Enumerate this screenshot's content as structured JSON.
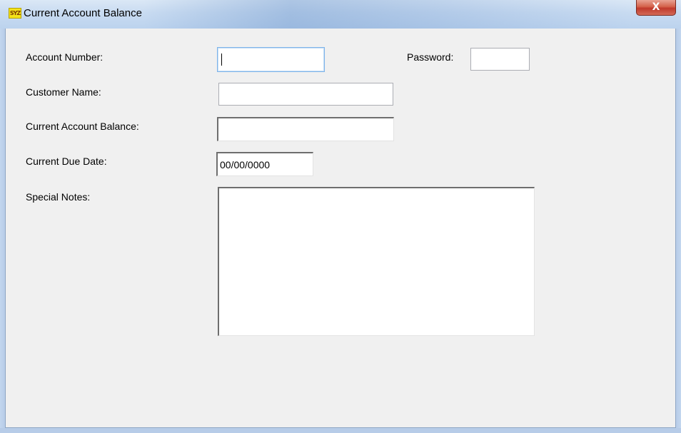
{
  "window": {
    "icon_text": "SYZ",
    "title": "Current Account Balance",
    "close_label": "X"
  },
  "form": {
    "account_number_label": "Account Number:",
    "account_number_value": "",
    "password_label": "Password:",
    "password_value": "",
    "customer_name_label": "Customer Name:",
    "customer_name_value": "",
    "balance_label": "Current Account Balance:",
    "balance_value": "",
    "due_date_label": "Current Due Date:",
    "due_date_value": "00/00/0000",
    "notes_label": "Special Notes:",
    "notes_value": ""
  }
}
